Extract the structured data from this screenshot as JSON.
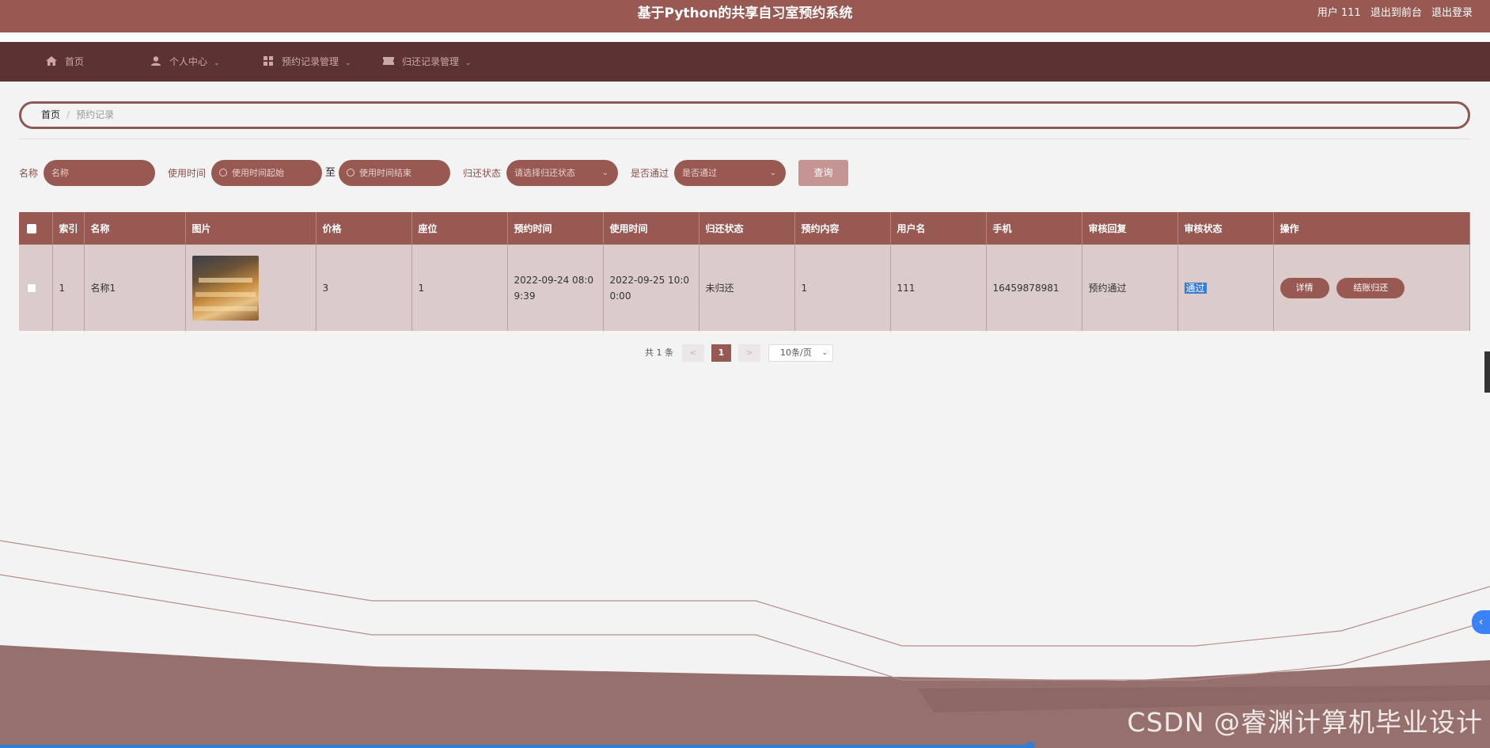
{
  "app": {
    "title": "基于Python的共享自习室预约系统",
    "user_label": "用户 111",
    "back_to_front": "退出到前台",
    "logout": "退出登录"
  },
  "nav": {
    "items": [
      {
        "label": "首页",
        "icon": "home-icon"
      },
      {
        "label": "个人中心",
        "icon": "user-icon"
      },
      {
        "label": "预约记录管理",
        "icon": "grid-icon"
      },
      {
        "label": "归还记录管理",
        "icon": "ticket-icon"
      }
    ]
  },
  "breadcrumb": {
    "home": "首页",
    "separator": "/",
    "current": "预约记录"
  },
  "filters": {
    "name_label": "名称",
    "name_placeholder": "名称",
    "time_label": "使用时间",
    "time_start_placeholder": "使用时间起始",
    "to_label": "至",
    "time_end_placeholder": "使用时间结束",
    "return_label": "归还状态",
    "return_placeholder": "请选择归还状态",
    "pass_label": "是否通过",
    "pass_placeholder": "是否通过",
    "query_button": "查询"
  },
  "table": {
    "headers": [
      "索引",
      "名称",
      "图片",
      "价格",
      "座位",
      "预约时间",
      "使用时间",
      "归还状态",
      "预约内容",
      "用户名",
      "手机",
      "审核回复",
      "审核状态",
      "操作"
    ],
    "rows": [
      {
        "index": "1",
        "name": "名称1",
        "price": "3",
        "seat": "1",
        "reserve_time": "2022-09-24 08:09:39",
        "use_time": "2022-09-25 10:00:00",
        "return_status": "未归还",
        "content": "1",
        "username": "111",
        "phone": "16459878981",
        "review_reply": "预约通过",
        "review_status": "通过",
        "actions": {
          "detail": "详情",
          "settle": "结账归还"
        }
      }
    ]
  },
  "pagination": {
    "total_text": "共 1 条",
    "prev": "<",
    "current_page": "1",
    "next": ">",
    "page_size": "10条/页"
  },
  "watermark": "CSDN @睿渊计算机毕业设计",
  "colors": {
    "primary": "#985953",
    "nav_bg": "#5c3330",
    "row_bg": "#dbcbcb",
    "query_button": "#c49592"
  }
}
